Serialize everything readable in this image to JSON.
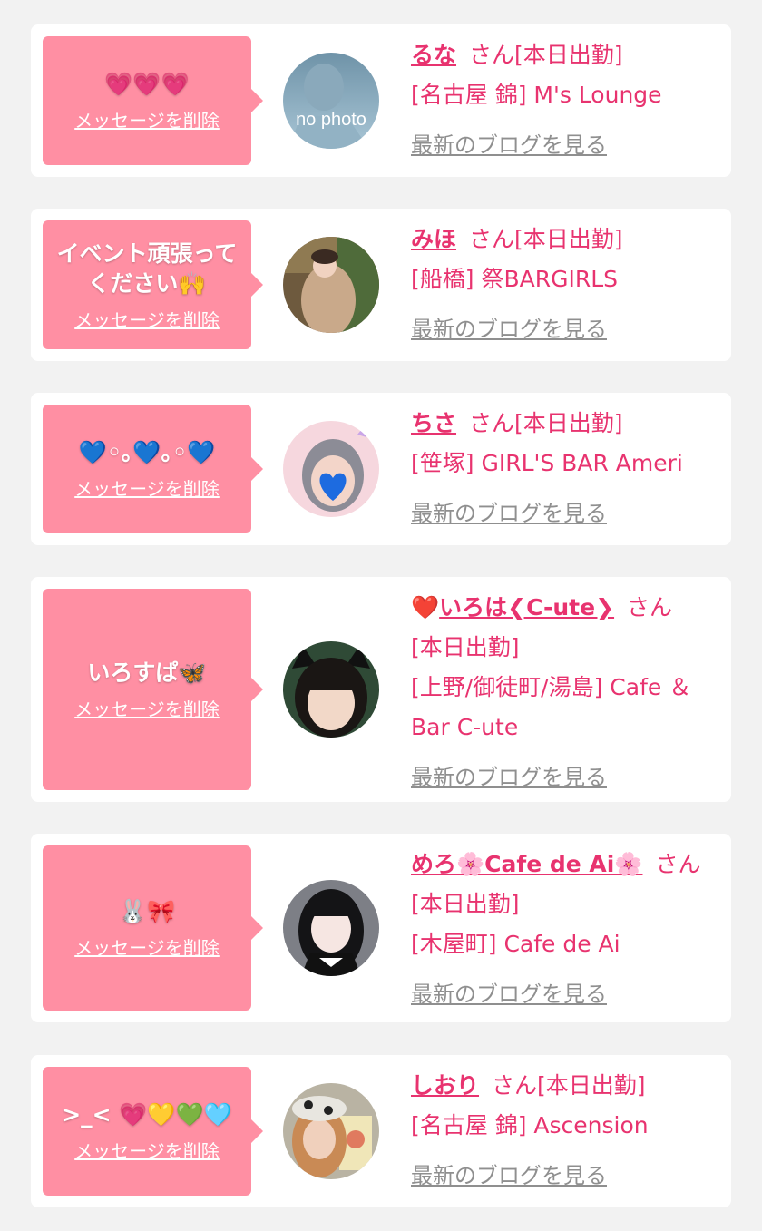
{
  "delete_label": "メッセージを削除",
  "blog_label": "最新のブログを見る",
  "colors": {
    "accent": "#e8336f",
    "bubble": "#ff8fa3",
    "link_gray": "#8f8f8f",
    "background": "#f2f2f2"
  },
  "entries": [
    {
      "message": "💗💗💗",
      "name": "るな",
      "honorific": "さん",
      "status": "[本日出勤]",
      "shop": "[名古屋 錦] M's Lounge",
      "avatar_text": "no photo"
    },
    {
      "message": "イベント頑張ってください🙌",
      "name": "みほ",
      "honorific": "さん",
      "status": "[本日出勤]",
      "shop": "[船橋] 祭BARGIRLS",
      "avatar_text": ""
    },
    {
      "message": "💙◦｡💙｡◦💙",
      "name": "ちさ",
      "honorific": "さん",
      "status": "[本日出勤]",
      "shop": "[笹塚] GIRL'S BAR Ameri",
      "avatar_text": ""
    },
    {
      "message": "いろすぱ🦋",
      "name": "いろは❮C-ute❯",
      "name_prefix": "❤️",
      "honorific": "さん",
      "status": "[本日出勤]",
      "shop": "[上野/御徒町/湯島] Cafe ＆Bar C-ute",
      "avatar_text": ""
    },
    {
      "message": "🐰🎀",
      "name": "めろ🌸Cafe de Ai🌸",
      "honorific": "さん",
      "status": "[本日出勤]",
      "shop": "[木屋町] Cafe de Ai",
      "avatar_text": ""
    },
    {
      "message": ">_< 💗💛💚🩵",
      "name": "しおり",
      "honorific": "さん",
      "status": "[本日出勤]",
      "shop": "[名古屋 錦] Ascension",
      "avatar_text": ""
    }
  ]
}
